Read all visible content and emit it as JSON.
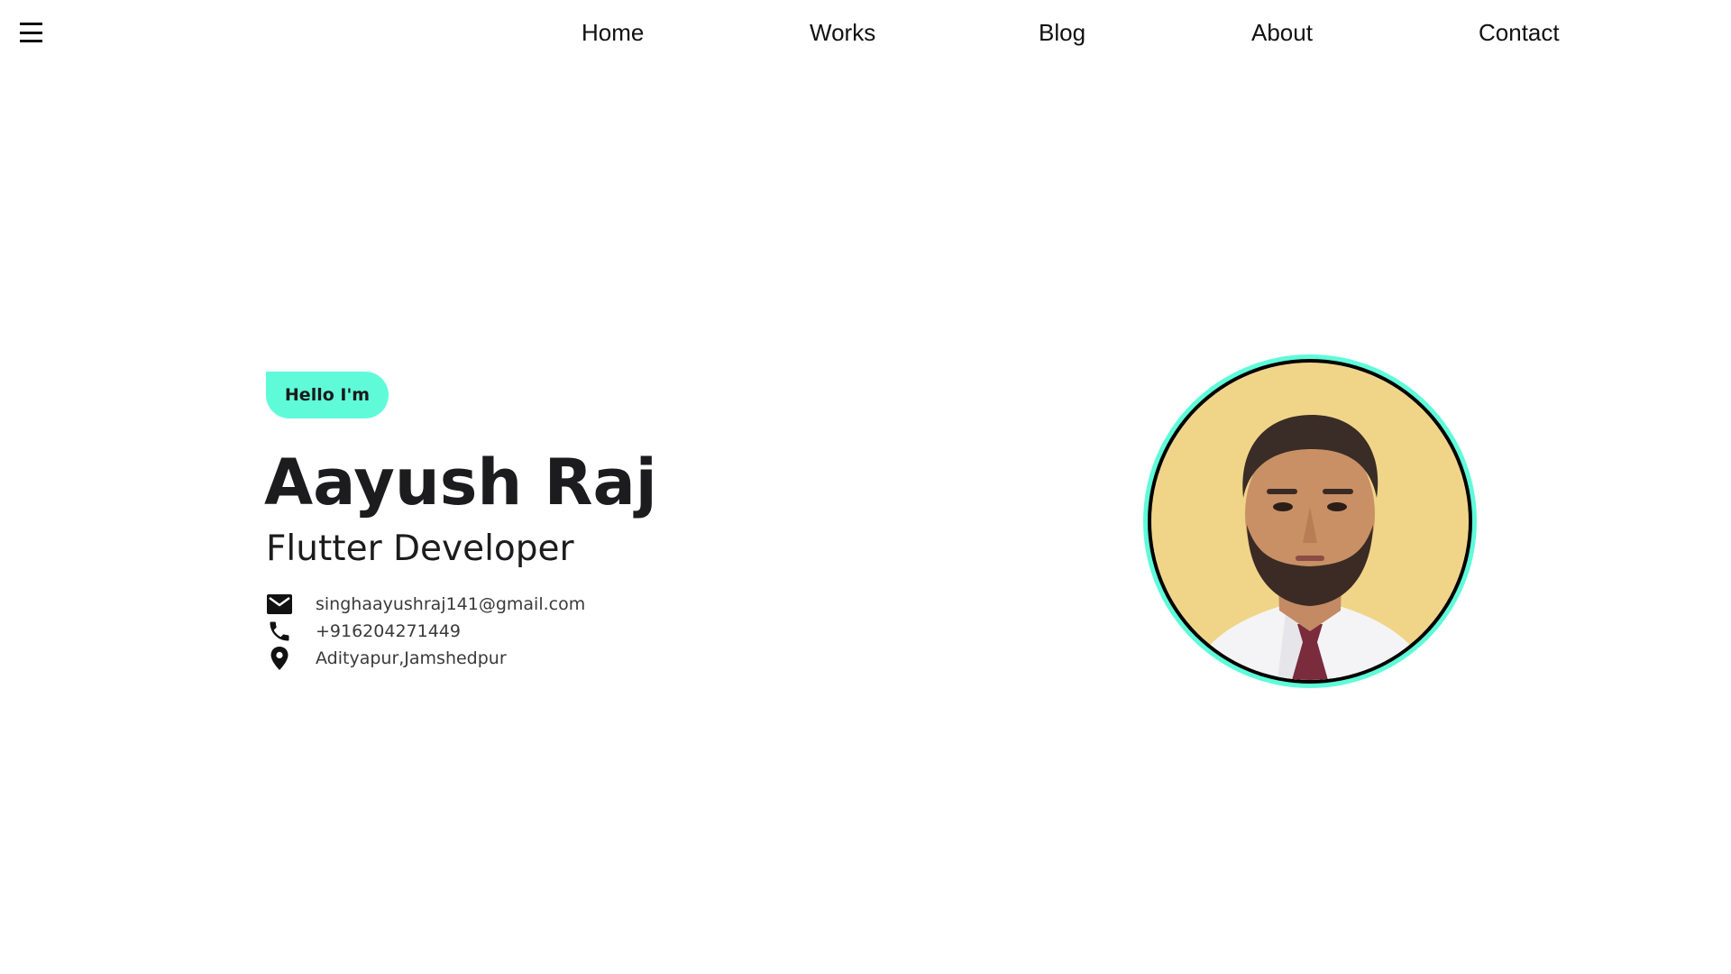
{
  "nav": {
    "menu_icon": "hamburger-menu-icon",
    "items": [
      {
        "label": "Home"
      },
      {
        "label": "Works"
      },
      {
        "label": "Blog"
      },
      {
        "label": "About"
      },
      {
        "label": "Contact"
      }
    ]
  },
  "hero": {
    "greeting": "Hello I'm",
    "name": "Aayush Raj",
    "role": "Flutter Developer",
    "contacts": [
      {
        "icon": "mail-icon",
        "text": "singhaayushraj141@gmail.com"
      },
      {
        "icon": "phone-icon",
        "text": "+916204271449"
      },
      {
        "icon": "location-pin-icon",
        "text": "Adityapur,Jamshedpur"
      }
    ],
    "avatar": "profile-photo"
  },
  "colors": {
    "accent": "#5ffbd9",
    "text_dark": "#1c1c1e",
    "text_muted": "#3a3a3c",
    "background": "#ffffff"
  }
}
